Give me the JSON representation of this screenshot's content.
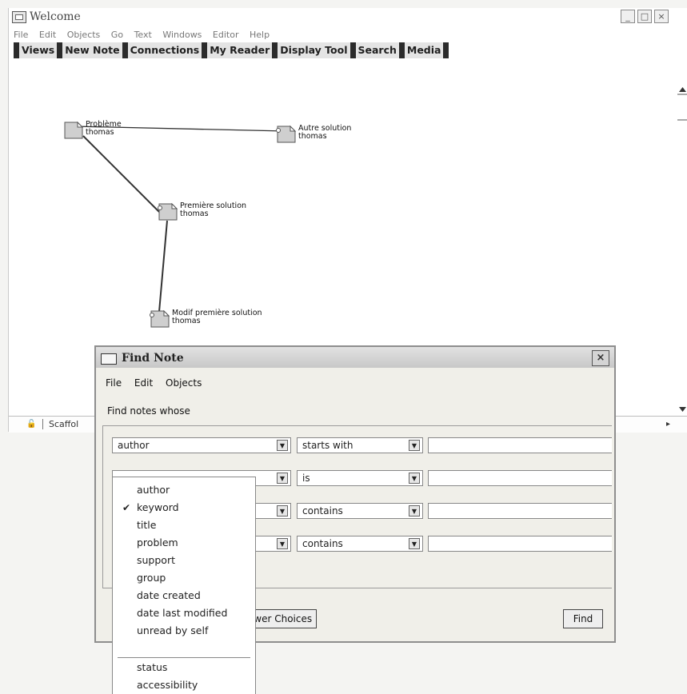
{
  "window": {
    "title": "Welcome",
    "menu": [
      "File",
      "Edit",
      "Objects",
      "Go",
      "Text",
      "Windows",
      "Editor",
      "Help"
    ],
    "toolbar": [
      "Views",
      "New Note",
      "Connections",
      "My Reader",
      "Display Tool",
      "Search",
      "Media"
    ],
    "status_label": "Scaffol"
  },
  "notes": [
    {
      "title": "Problème",
      "author": "thomas"
    },
    {
      "title": "Autre solution",
      "author": "thomas"
    },
    {
      "title": "Première solution",
      "author": "thomas"
    },
    {
      "title": "Modif première solution",
      "author": "thomas"
    }
  ],
  "dialog": {
    "title": "Find Note",
    "menu": [
      "File",
      "Edit",
      "Objects"
    ],
    "prompt": "Find notes whose",
    "rows": [
      {
        "field": "author",
        "operator": "starts with",
        "value": ""
      },
      {
        "field": "",
        "operator": "is",
        "value": ""
      },
      {
        "field": "",
        "operator": "contains",
        "value": ""
      },
      {
        "field": "",
        "operator": "contains",
        "value": ""
      }
    ],
    "fewer_choices_label": "ewer Choices",
    "find_label": "Find"
  },
  "dropdown": {
    "items": [
      {
        "label": "author",
        "checked": false
      },
      {
        "label": "keyword",
        "checked": true
      },
      {
        "label": "title",
        "checked": false
      },
      {
        "label": "problem",
        "checked": false
      },
      {
        "label": "support",
        "checked": false
      },
      {
        "label": "group",
        "checked": false
      },
      {
        "label": "date created",
        "checked": false
      },
      {
        "label": "date last modified",
        "checked": false
      },
      {
        "label": "unread by self",
        "checked": false
      }
    ],
    "extra_items": [
      {
        "label": "status"
      },
      {
        "label": "accessibility"
      }
    ]
  }
}
